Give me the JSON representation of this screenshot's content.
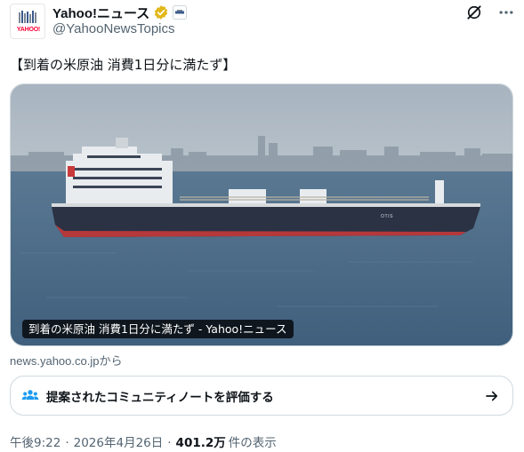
{
  "author": {
    "display_name": "Yahoo!ニュース",
    "handle": "@YahooNewsTopics",
    "avatar_text": "YAHOO!",
    "verified_badge": "gold-check-icon",
    "affiliate_badge": "square-logo-icon"
  },
  "actions": {
    "grok_icon": "grok-icon",
    "more_icon": "more-icon"
  },
  "tweet": {
    "text": "【到着の米原油 消費1日分に満たず】"
  },
  "media": {
    "caption": "到着の米原油 消費1日分に満たず - Yahoo!ニュース",
    "hull_marking": "OTIS"
  },
  "link": {
    "source": "news.yahoo.co.jpから"
  },
  "community_note": {
    "label": "提案されたコミュニティノートを評価する",
    "icon": "people-icon",
    "arrow_icon": "arrow-right-icon"
  },
  "meta": {
    "time": "午後9:22",
    "date": "2026年4月26日",
    "separator": "·",
    "views": "401.2万",
    "views_suffix": "件の表示"
  },
  "colors": {
    "verified_gold": "#e2b719",
    "text_primary": "#0f1419",
    "text_secondary": "#536471",
    "border": "#cfd9de",
    "community_blue": "#1d9bf0"
  }
}
